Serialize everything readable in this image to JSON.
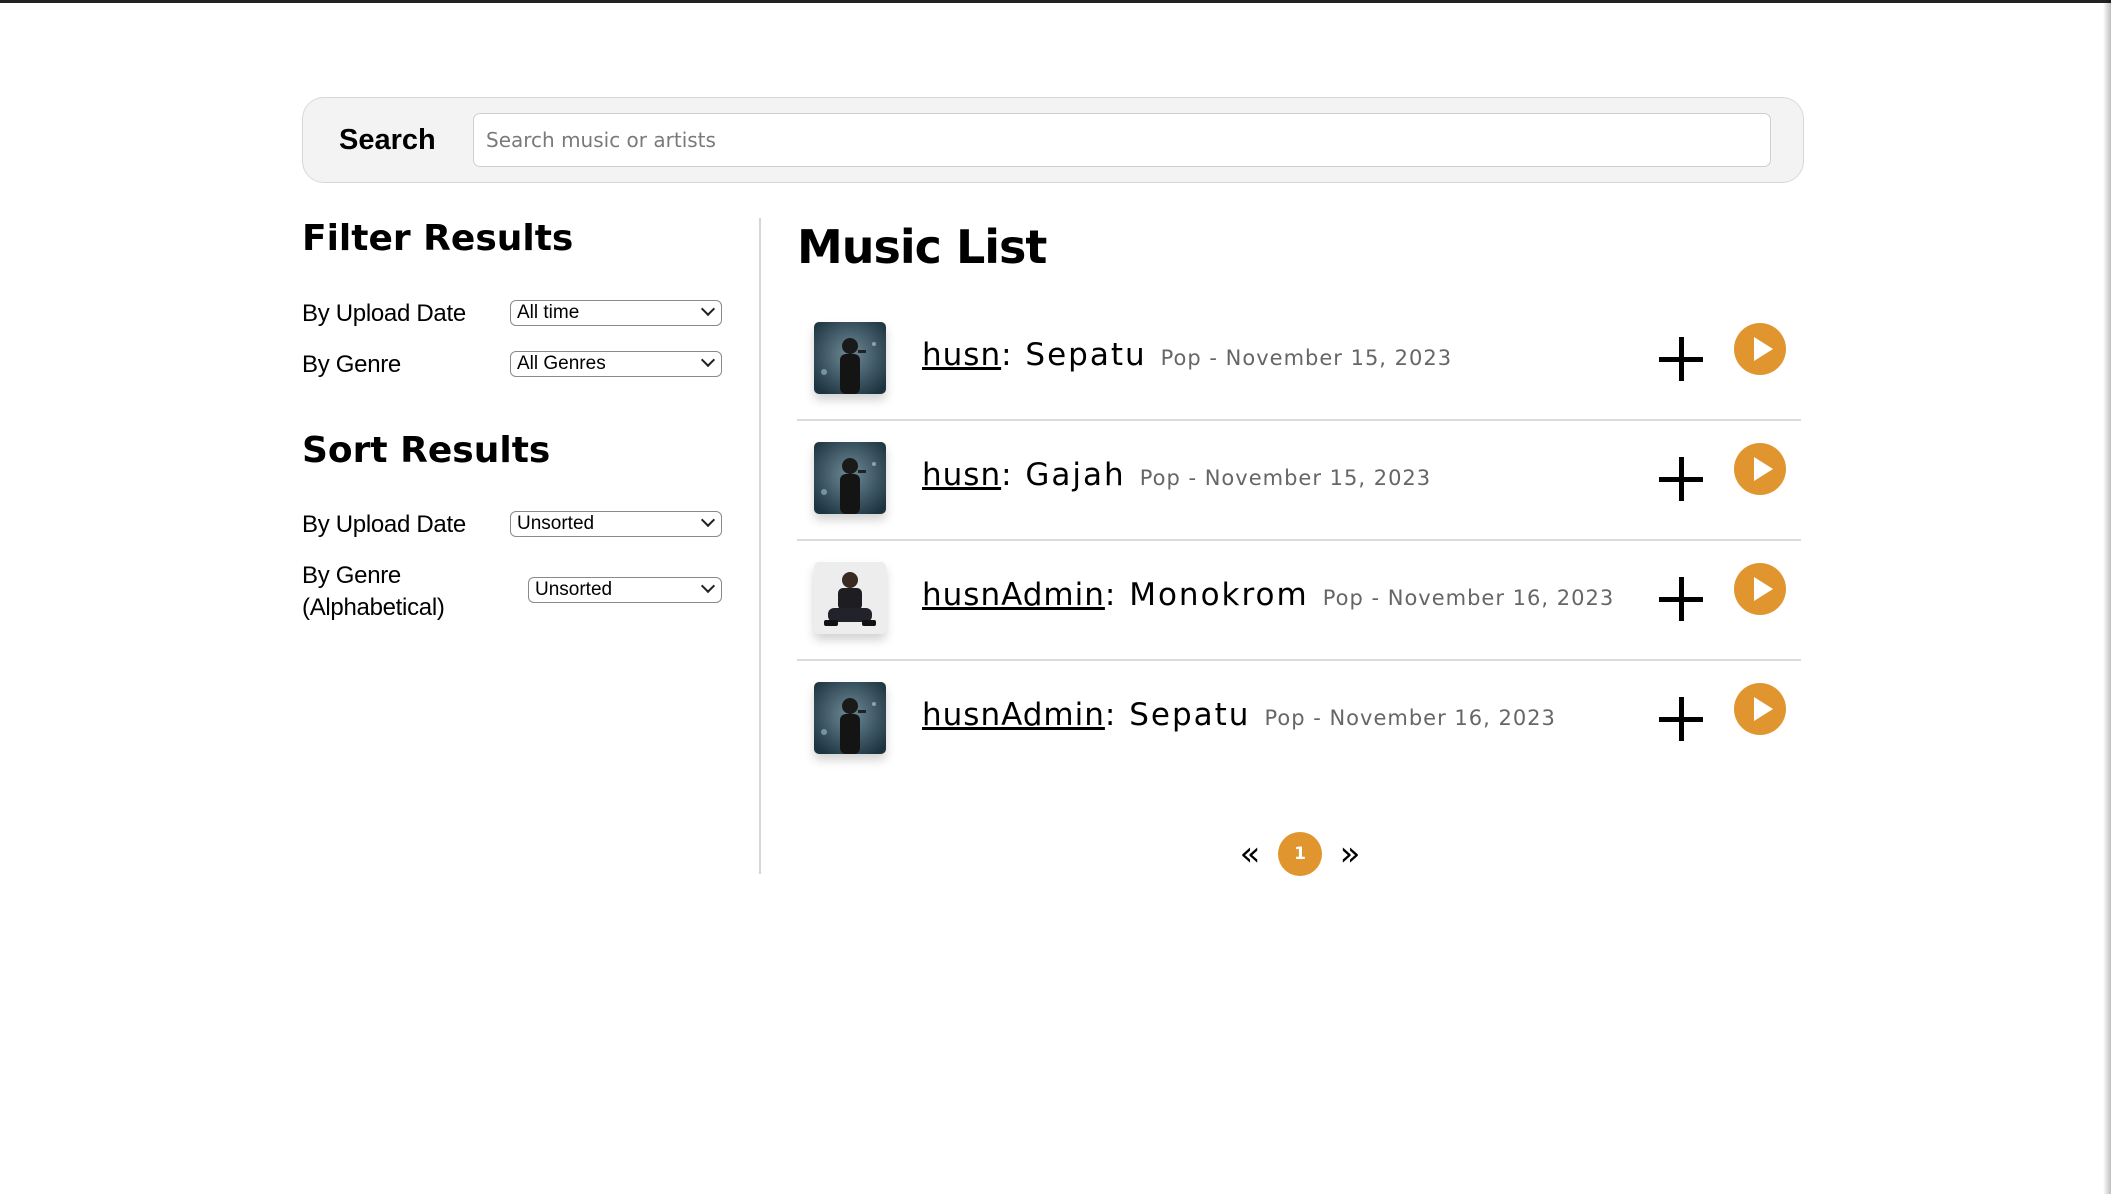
{
  "search": {
    "label": "Search",
    "placeholder": "Search music or artists",
    "value": ""
  },
  "filter": {
    "title": "Filter Results",
    "rows": [
      {
        "label": "By Upload Date",
        "value": "All time"
      },
      {
        "label": "By Genre",
        "value": "All Genres"
      }
    ]
  },
  "sort": {
    "title": "Sort Results",
    "rows": [
      {
        "label": "By Upload Date",
        "value": "Unsorted"
      },
      {
        "label": "By Genre (Alphabetical)",
        "label_line1": "By Genre",
        "label_line2": "(Alphabetical)",
        "value": "Unsorted"
      }
    ]
  },
  "music": {
    "title": "Music List",
    "tracks": [
      {
        "artist": "husn",
        "title": "Sepatu",
        "meta": "Pop - November 15, 2023",
        "cover": "singer-photo"
      },
      {
        "artist": "husn",
        "title": "Gajah",
        "meta": "Pop - November 15, 2023",
        "cover": "singer-photo"
      },
      {
        "artist": "husnAdmin",
        "title": "Monokrom",
        "meta": "Pop - November 16, 2023",
        "cover": "seated-man-photo"
      },
      {
        "artist": "husnAdmin",
        "title": "Sepatu",
        "meta": "Pop - November 16, 2023",
        "cover": "singer-photo"
      }
    ]
  },
  "pagination": {
    "prev": "«",
    "current": "1",
    "next": "»"
  },
  "icons": {
    "add": "plus-icon",
    "play": "play-icon",
    "chevron": "chevron-down-icon"
  },
  "colors": {
    "accent": "#e0952f",
    "search_bg": "#f3f3f3",
    "meta_text": "#666666"
  }
}
